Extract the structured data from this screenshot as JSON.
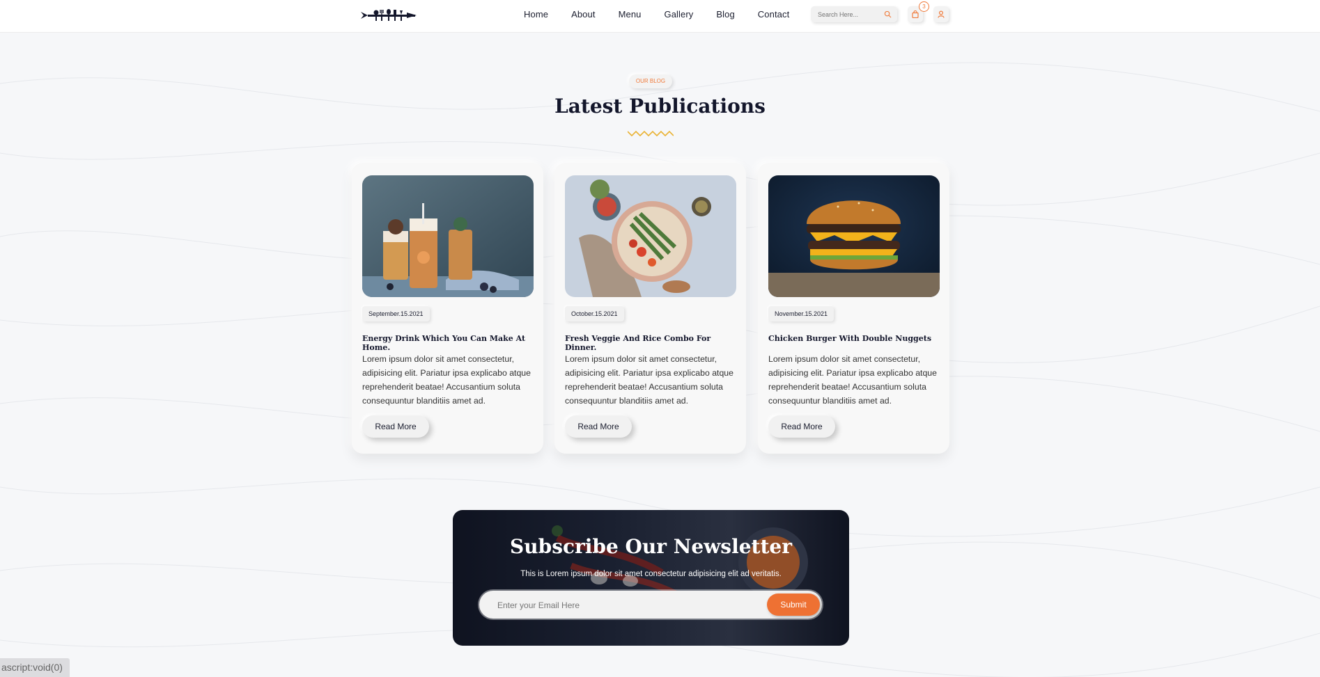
{
  "header": {
    "logo_label": "logo",
    "nav": [
      "Home",
      "About",
      "Menu",
      "Gallery",
      "Blog",
      "Contact"
    ],
    "search_placeholder": "Search Here...",
    "cart_count": "3"
  },
  "blog": {
    "badge": "OUR BLOG",
    "title": "Latest Publications",
    "posts": [
      {
        "date": "September.15.2021",
        "title": "Energy Drink Which You Can Make At Home.",
        "text": "Lorem ipsum dolor sit amet consectetur, adipisicing elit. Pariatur ipsa explicabo atque reprehenderit beatae! Accusantium soluta consequuntur blanditiis amet ad.",
        "button": "Read More",
        "image": "smoothie-glasses-photo"
      },
      {
        "date": "October.15.2021",
        "title": "Fresh Veggie And Rice Combo For Dinner.",
        "text": "Lorem ipsum dolor sit amet consectetur, adipisicing elit. Pariatur ipsa explicabo atque reprehenderit beatae! Accusantium soluta consequuntur blanditiis amet ad.",
        "button": "Read More",
        "image": "veggie-rice-bowl-photo"
      },
      {
        "date": "November.15.2021",
        "title": "Chicken Burger With Double Nuggets",
        "text": "Lorem ipsum dolor sit amet consectetur, adipisicing elit. Pariatur ipsa explicabo atque reprehenderit beatae! Accusantium soluta consequuntur blanditiis amet ad.",
        "button": "Read More",
        "image": "double-burger-photo"
      }
    ]
  },
  "newsletter": {
    "title": "Subscribe Our Newsletter",
    "subtitle": "This is Lorem ipsum dolor sit amet consectetur adipisicing elit ad veritatis.",
    "placeholder": "Enter your Email Here",
    "submit": "Submit"
  },
  "status_bar": "ascript:void(0)",
  "colors": {
    "accent": "#ee7133",
    "dark": "#13162b",
    "zigzag": "#e9b233"
  }
}
